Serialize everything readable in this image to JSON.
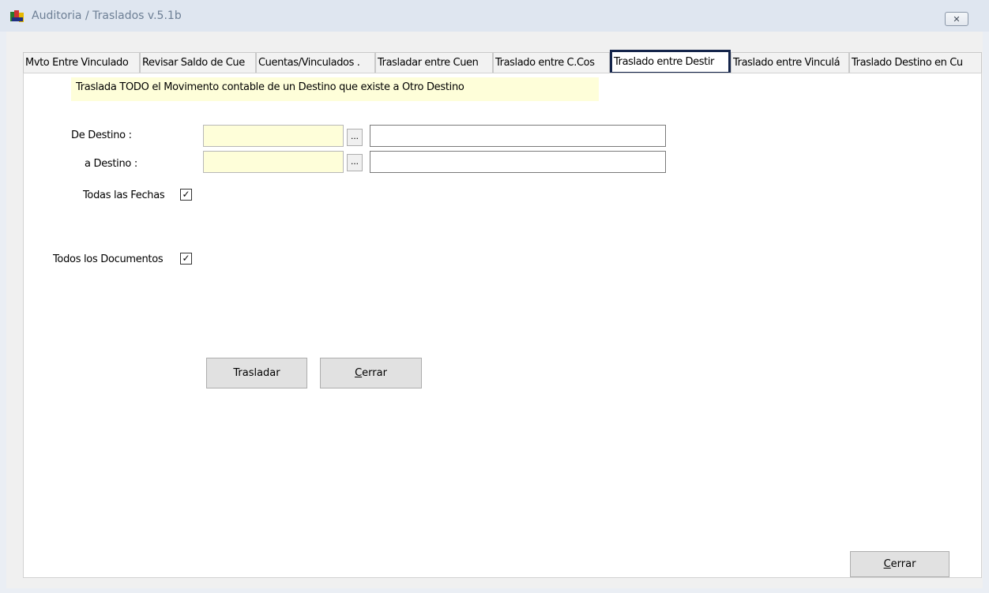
{
  "window": {
    "title": "Auditoria / Traslados  v.5.1b",
    "close_label": "✕"
  },
  "tabs": [
    {
      "label": "Mvto Entre Vinculado"
    },
    {
      "label": "Revisar Saldo de Cue"
    },
    {
      "label": "Cuentas/Vinculados ."
    },
    {
      "label": "Trasladar entre Cuen"
    },
    {
      "label": "Traslado entre C.Cos"
    },
    {
      "label": "Traslado entre Destir",
      "active": true
    },
    {
      "label": "Traslado entre Vinculá"
    },
    {
      "label": "Traslado Destino en Cu"
    }
  ],
  "panel": {
    "banner": "Traslada TODO el Movimento contable de un Destino que existe a Otro Destino",
    "de_destino": {
      "label": "De Destino :",
      "code": "",
      "description": "",
      "lookup": "..."
    },
    "a_destino": {
      "label": "a Destino :",
      "code": "",
      "description": "",
      "lookup": "..."
    },
    "todas_fechas": {
      "label": "Todas las Fechas",
      "checked": true,
      "mark": "✓"
    },
    "todos_documentos": {
      "label": "Todos los Documentos",
      "checked": true,
      "mark": "✓"
    },
    "trasladar_label": "Trasladar",
    "cerrar_label": "errar",
    "cerrar_accel": "C"
  },
  "footer": {
    "cerrar_accel": "C",
    "cerrar_label": "errar"
  },
  "colors": {
    "active_tab_border": "#14244a",
    "input_highlight": "#fefed9",
    "title_text": "#6d7f95"
  }
}
